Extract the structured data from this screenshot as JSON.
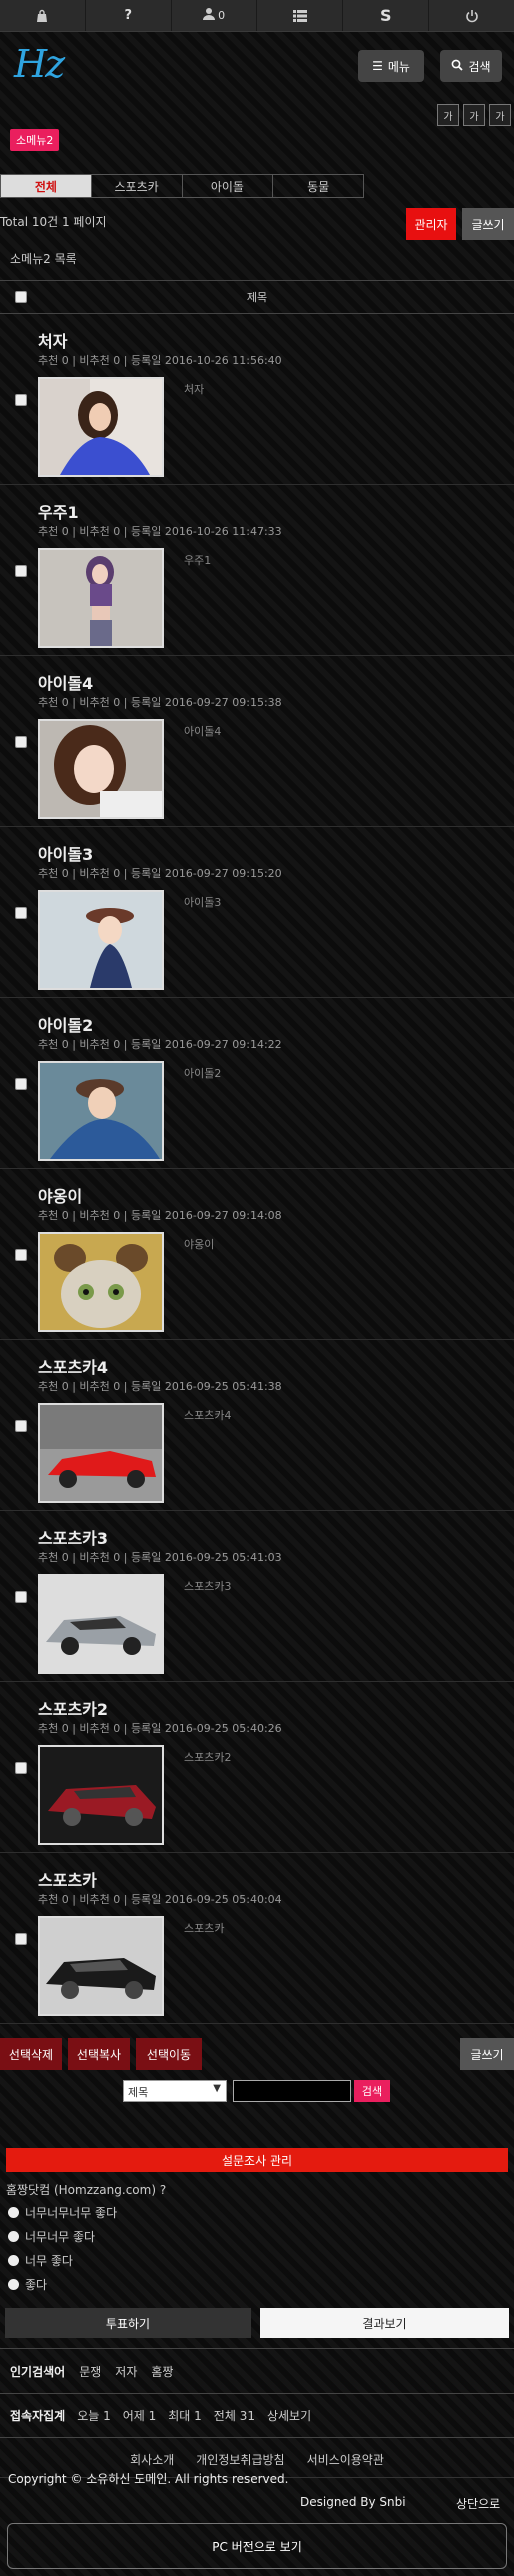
{
  "topbar": {
    "icons": [
      "bag-icon",
      "question-icon",
      "user-icon",
      "list-icon",
      "s-icon",
      "power-icon"
    ],
    "user_count": "0"
  },
  "header": {
    "logo": "Hz",
    "menu_label": "메뉴",
    "search_label": "검색"
  },
  "font_size_buttons": [
    "가",
    "가",
    "가"
  ],
  "category_badge": "소메뉴2",
  "tabs": [
    {
      "label": "전체",
      "active": true
    },
    {
      "label": "스포츠카",
      "active": false
    },
    {
      "label": "아이돌",
      "active": false
    },
    {
      "label": "동물",
      "active": false
    }
  ],
  "summary": {
    "total": "Total 10건 1 페이지",
    "admin_label": "관리자",
    "write_label": "글쓰기",
    "list_title": "소메뉴2 목록",
    "title_col": "제목"
  },
  "posts": [
    {
      "title": "처자",
      "meta": "추천 0 | 비추천 0 | 등록일 2016-10-26 11:56:40",
      "summary": "처자",
      "thumb": "girl-blue"
    },
    {
      "title": "우주1",
      "meta": "추천 0 | 비추천 0 | 등록일 2016-10-26 11:47:33",
      "summary": "우주1",
      "thumb": "girl-purple"
    },
    {
      "title": "아이돌4",
      "meta": "추천 0 | 비추천 0 | 등록일 2016-09-27 09:15:38",
      "summary": "아이돌4",
      "thumb": "girl-grey"
    },
    {
      "title": "아이돌3",
      "meta": "추천 0 | 비추천 0 | 등록일 2016-09-27 09:15:20",
      "summary": "아이돌3",
      "thumb": "girl-hat"
    },
    {
      "title": "아이돌2",
      "meta": "추천 0 | 비추천 0 | 등록일 2016-09-27 09:14:22",
      "summary": "아이돌2",
      "thumb": "girl-denim"
    },
    {
      "title": "야옹이",
      "meta": "추천 0 | 비추천 0 | 등록일 2016-09-27 09:14:08",
      "summary": "야옹이",
      "thumb": "cat"
    },
    {
      "title": "스포츠카4",
      "meta": "추천 0 | 비추천 0 | 등록일 2016-09-25 05:41:38",
      "summary": "스포츠카4",
      "thumb": "car-red"
    },
    {
      "title": "스포츠카3",
      "meta": "추천 0 | 비추천 0 | 등록일 2016-09-25 05:41:03",
      "summary": "스포츠카3",
      "thumb": "car-silver"
    },
    {
      "title": "스포츠카2",
      "meta": "추천 0 | 비추천 0 | 등록일 2016-09-25 05:40:26",
      "summary": "스포츠카2",
      "thumb": "car-darkred"
    },
    {
      "title": "스포츠카",
      "meta": "추천 0 | 비추천 0 | 등록일 2016-09-25 05:40:04",
      "summary": "스포츠카",
      "thumb": "car-black"
    }
  ],
  "actions": {
    "delete": "선택삭제",
    "copy": "선택복사",
    "move": "선택이동",
    "write": "글쓰기"
  },
  "search": {
    "select_value": "제목",
    "button": "검색"
  },
  "poll": {
    "header": "설문조사 관리",
    "question": "홈짱닷컴 (Homzzang.com) ?",
    "options": [
      "너무너무너무 좋다",
      "너무너무 좋다",
      "너무 좋다",
      "좋다"
    ],
    "vote": "투표하기",
    "result": "결과보기"
  },
  "popular": {
    "label": "인기검색어",
    "words": [
      "문쟁",
      "저자",
      "홈짱"
    ]
  },
  "visitors": {
    "label": "접속자집계",
    "items": [
      "오늘 1",
      "어제 1",
      "최대 1",
      "전체 31",
      "상세보기"
    ]
  },
  "footer": {
    "links": [
      "회사소개",
      "개인정보취급방침",
      "서비스이용약관"
    ],
    "copyright": "Copyright © 소유하신 도메인. All rights reserved.",
    "designed": "Designed By Snbi",
    "top": "상단으로",
    "pc_view": "PC 버전으로 보기"
  },
  "colors": {
    "accent_red": "#e41b0f",
    "pink": "#ea1f5e",
    "dark_red": "#7a0f14",
    "logo_blue": "#2fa4e0"
  }
}
